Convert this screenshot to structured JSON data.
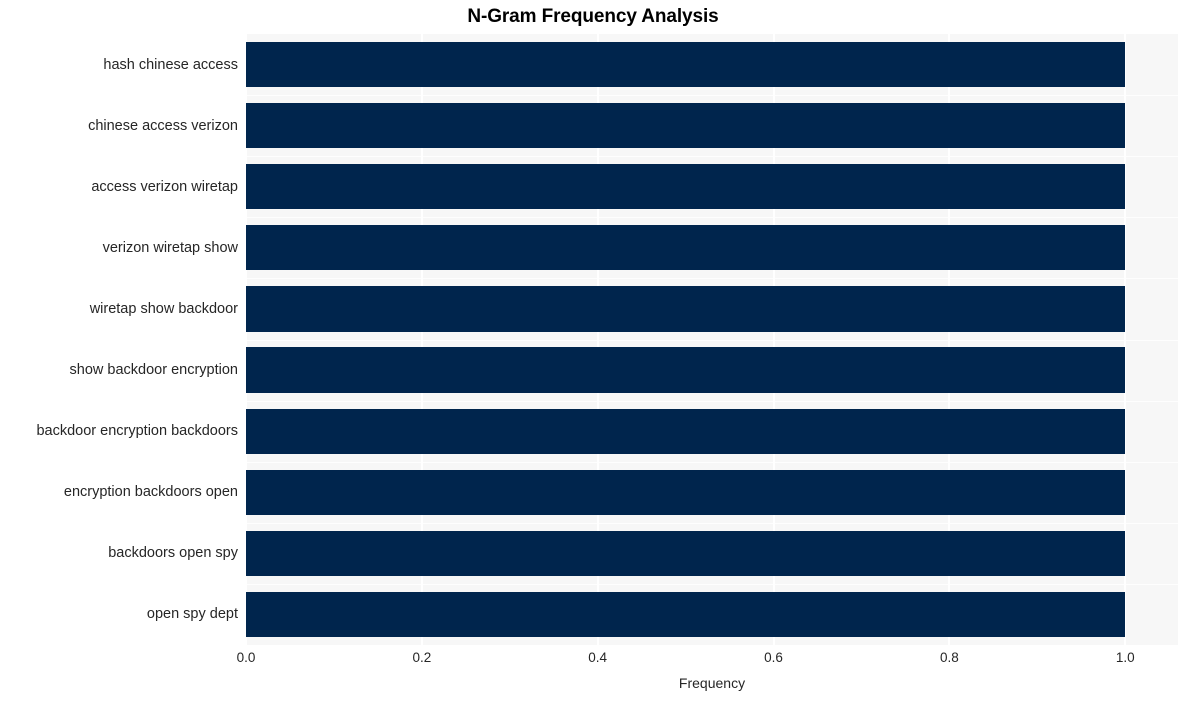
{
  "chart_data": {
    "type": "bar",
    "orientation": "horizontal",
    "title": "N-Gram Frequency Analysis",
    "xlabel": "Frequency",
    "ylabel": "",
    "categories": [
      "hash chinese access",
      "chinese access verizon",
      "access verizon wiretap",
      "verizon wiretap show",
      "wiretap show backdoor",
      "show backdoor encryption",
      "backdoor encryption backdoors",
      "encryption backdoors open",
      "backdoors open spy",
      "open spy dept"
    ],
    "values": [
      1.0,
      1.0,
      1.0,
      1.0,
      1.0,
      1.0,
      1.0,
      1.0,
      1.0,
      1.0
    ],
    "xlim": [
      0.0,
      1.06
    ],
    "xticks": [
      "0.0",
      "0.2",
      "0.4",
      "0.6",
      "0.8",
      "1.0"
    ],
    "xtick_values": [
      0.0,
      0.2,
      0.4,
      0.6,
      0.8,
      1.0
    ],
    "grid": true,
    "legend": null,
    "bar_color": "#00254d",
    "plot_background": "#f7f7f7",
    "gridline_color": "#ffffff",
    "text_color": "#262626"
  }
}
